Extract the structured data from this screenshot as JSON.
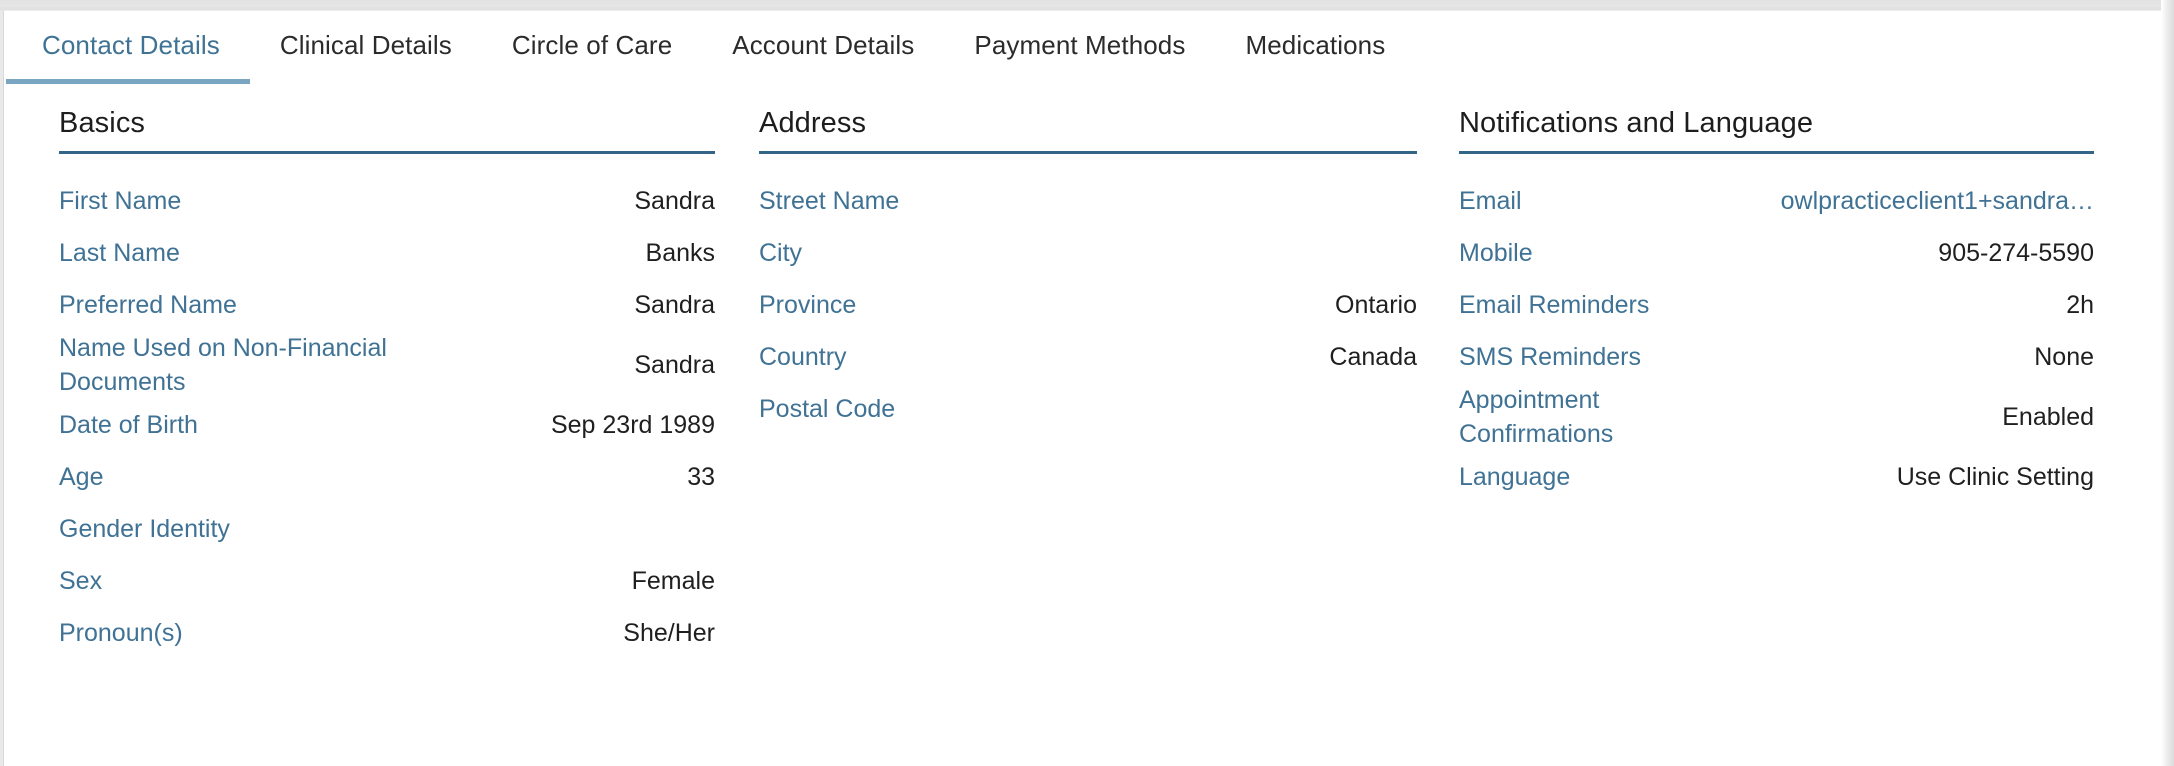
{
  "tabs": [
    {
      "label": "Contact Details",
      "active": true
    },
    {
      "label": "Clinical Details",
      "active": false
    },
    {
      "label": "Circle of Care",
      "active": false
    },
    {
      "label": "Account Details",
      "active": false
    },
    {
      "label": "Payment Methods",
      "active": false
    },
    {
      "label": "Medications",
      "active": false
    }
  ],
  "colors": {
    "accent_blue": "#3f7294",
    "heading_rule": "#326588",
    "tab_underline": "#7aa6c2",
    "value_text": "#1f1f1f",
    "page_background": "#ffffff"
  },
  "columns": [
    {
      "title": "Basics",
      "rows": [
        {
          "label": "First Name",
          "value": "Sandra"
        },
        {
          "label": "Last Name",
          "value": "Banks"
        },
        {
          "label": "Preferred Name",
          "value": "Sandra"
        },
        {
          "label": "Name Used on Non-Financial Documents",
          "value": "Sandra"
        },
        {
          "label": "Date of Birth",
          "value": "Sep 23rd 1989"
        },
        {
          "label": "Age",
          "value": "33"
        },
        {
          "label": "Gender Identity",
          "value": ""
        },
        {
          "label": "Sex",
          "value": "Female"
        },
        {
          "label": "Pronoun(s)",
          "value": "She/Her"
        }
      ]
    },
    {
      "title": "Address",
      "rows": [
        {
          "label": "Street Name",
          "value": ""
        },
        {
          "label": "City",
          "value": ""
        },
        {
          "label": "Province",
          "value": "Ontario"
        },
        {
          "label": "Country",
          "value": "Canada"
        },
        {
          "label": "Postal Code",
          "value": ""
        }
      ]
    },
    {
      "title": "Notifications and Language",
      "rows": [
        {
          "label": "Email",
          "value": "owlpracticeclient1+sandra…",
          "link": true
        },
        {
          "label": "Mobile",
          "value": "905-274-5590"
        },
        {
          "label": "Email Reminders",
          "value": "2h"
        },
        {
          "label": "SMS Reminders",
          "value": "None"
        },
        {
          "label": "Appointment Confirmations",
          "value": "Enabled"
        },
        {
          "label": "Language",
          "value": "Use Clinic Setting"
        }
      ]
    }
  ]
}
